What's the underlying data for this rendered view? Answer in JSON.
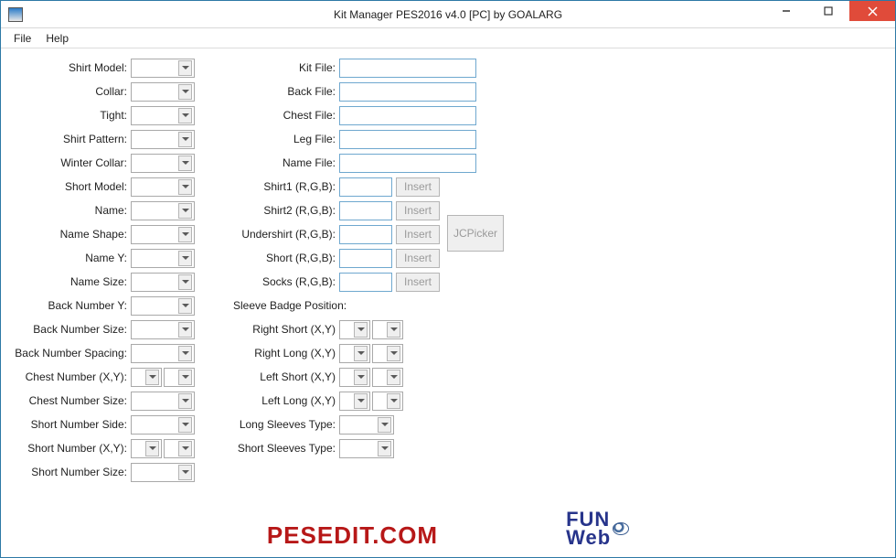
{
  "window": {
    "title": "Kit Manager PES2016 v4.0 [PC] by GOALARG"
  },
  "menubar": {
    "file": "File",
    "help": "Help"
  },
  "left": {
    "shirt_model": "Shirt Model:",
    "collar": "Collar:",
    "tight": "Tight:",
    "shirt_pattern": "Shirt Pattern:",
    "winter_collar": "Winter Collar:",
    "short_model": "Short Model:",
    "name": "Name:",
    "name_shape": "Name Shape:",
    "name_y": "Name Y:",
    "name_size": "Name Size:",
    "back_number_y": "Back Number Y:",
    "back_number_size": "Back Number Size:",
    "back_number_spacing": "Back Number Spacing:",
    "chest_number_xy": "Chest Number (X,Y):",
    "chest_number_size": "Chest Number Size:",
    "short_number_side": "Short Number Side:",
    "short_number_xy": "Short Number (X,Y):",
    "short_number_size": "Short Number Size:"
  },
  "right": {
    "kit_file": "Kit File:",
    "back_file": "Back File:",
    "chest_file": "Chest File:",
    "leg_file": "Leg File:",
    "name_file": "Name File:",
    "shirt1_rgb": "Shirt1 (R,G,B):",
    "shirt2_rgb": "Shirt2 (R,G,B):",
    "undershirt_rgb": "Undershirt (R,G,B):",
    "short_rgb": "Short (R,G,B):",
    "socks_rgb": "Socks (R,G,B):",
    "sleeve_badge": "Sleeve Badge Position:",
    "right_short_xy": "Right Short (X,Y)",
    "right_long_xy": "Right Long (X,Y)",
    "left_short_xy": "Left Short (X,Y)",
    "left_long_xy": "Left Long (X,Y)",
    "long_sleeves_type": "Long Sleeves Type:",
    "short_sleeves_type": "Short Sleeves Type:"
  },
  "buttons": {
    "insert": "Insert",
    "jcpicker": "JCPicker"
  },
  "footer": {
    "pesedit": "PESEDIT.COM",
    "fun": "FUN",
    "web": "Web"
  }
}
